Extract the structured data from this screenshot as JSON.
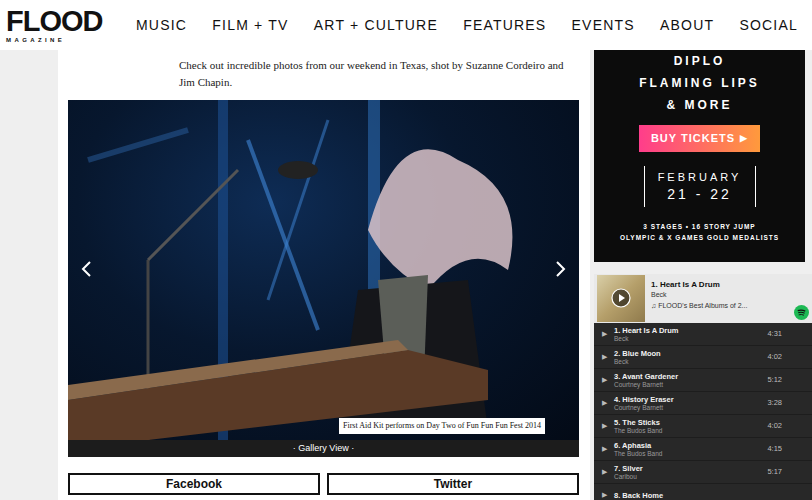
{
  "logo": {
    "title": "FLOOD",
    "subtitle": "MAGAZINE"
  },
  "nav": [
    {
      "label": "MUSIC"
    },
    {
      "label": "FILM + TV"
    },
    {
      "label": "ART + CULTURE"
    },
    {
      "label": "FEATURES"
    },
    {
      "label": "EVENTS"
    },
    {
      "label": "ABOUT"
    },
    {
      "label": "SOCIAL"
    }
  ],
  "intro": "Check out incredible photos from our weekend in Texas, shot by Suzanne Cordeiro and Jim Chapin.",
  "gallery": {
    "caption": "First Aid Kit performs on Day Two of Fun Fun Fun Fest 2014",
    "view_label": "· Gallery View ·"
  },
  "share_buttons": [
    "Facebook",
    "Twitter"
  ],
  "ad": {
    "headliners": [
      "DIPLO",
      "FLAMING LIPS",
      "& MORE"
    ],
    "button": "BUY TICKETS",
    "button_icon": "▶",
    "month": "FEBRUARY",
    "dates": "21 - 22",
    "details": [
      "3 STAGES • 16 STORY JUMP",
      "OLYMPIC & X GAMES GOLD MEDALISTS"
    ]
  },
  "player": {
    "now_playing": {
      "title": "1. Heart Is A Drum",
      "artist": "Beck",
      "playlist": "♫ FLOOD's Best Albums of 2..."
    },
    "play_icon": "▶",
    "tracks": [
      {
        "title": "1. Heart Is A Drum",
        "artist": "Beck",
        "duration": "4:31"
      },
      {
        "title": "2. Blue Moon",
        "artist": "Beck",
        "duration": "4:02"
      },
      {
        "title": "3. Avant Gardener",
        "artist": "Courtney Barnett",
        "duration": "5:12"
      },
      {
        "title": "4. History Eraser",
        "artist": "Courtney Barnett",
        "duration": "3:28"
      },
      {
        "title": "5. The Sticks",
        "artist": "The Budos Band",
        "duration": "4:02"
      },
      {
        "title": "6. Aphasia",
        "artist": "The Budos Band",
        "duration": "4:15"
      },
      {
        "title": "7. Silver",
        "artist": "Caribou",
        "duration": "5:17"
      },
      {
        "title": "8. Back Home"
      }
    ]
  }
}
